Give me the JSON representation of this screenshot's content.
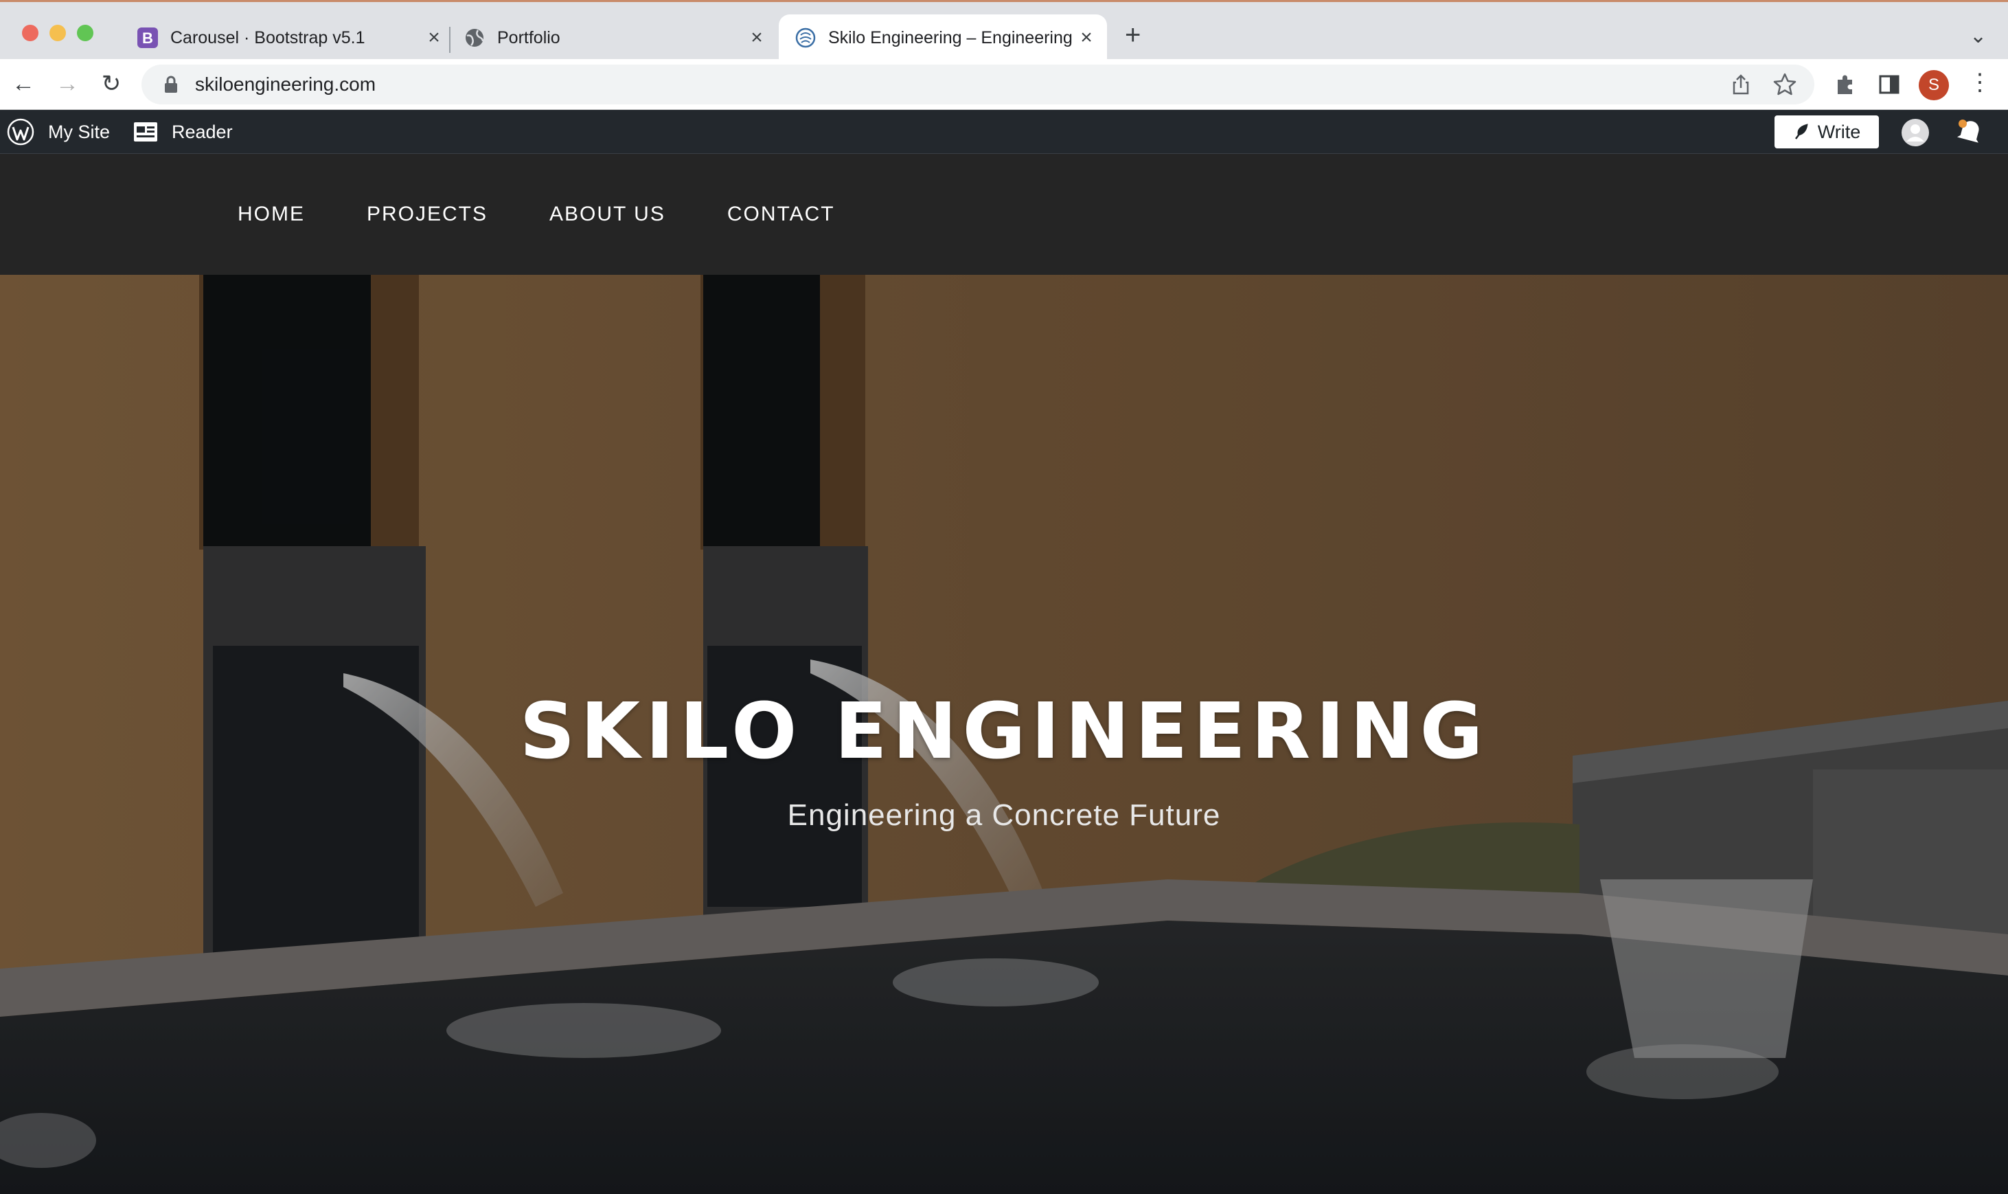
{
  "browser": {
    "tabs": [
      {
        "title": "Carousel · Bootstrap v5.1",
        "favicon": "bootstrap-icon",
        "active": false
      },
      {
        "title": "Portfolio",
        "favicon": "globe-icon",
        "active": false
      },
      {
        "title": "Skilo Engineering – Engineering a Concrete Future",
        "favicon": "site-icon",
        "active": true
      }
    ],
    "url": "skiloengineering.com",
    "profile_initial": "S",
    "icons": [
      "back-icon",
      "forward-icon",
      "reload-icon",
      "lock-icon",
      "share-icon",
      "star-icon",
      "extensions-icon",
      "side-panel-icon",
      "menu-icon"
    ]
  },
  "wp_admin_bar": {
    "my_site_label": "My Site",
    "reader_label": "Reader",
    "write_label": "Write"
  },
  "site": {
    "menu": [
      "HOME",
      "PROJECTS",
      "ABOUT US",
      "CONTACT"
    ],
    "hero": {
      "title": "SKILO ENGINEERING",
      "subtitle": "Engineering a Concrete Future"
    }
  },
  "colors": {
    "header_bg": "#252525",
    "wp_bar_bg": "#23282d",
    "wall": "#8a6b47",
    "profile_avatar": "#c2462a"
  }
}
